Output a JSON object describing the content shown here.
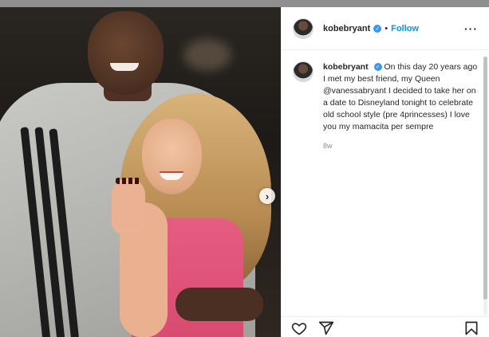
{
  "post": {
    "username": "kobebryant",
    "follow_label": "Follow",
    "separator": "•",
    "more_icon": "more-horizontal-icon",
    "verified_icon": "verified-badge-icon",
    "caption_text": "On this day 20 years ago I met my best friend, my Queen @vanessabryant I decided to take her on a date to Disneyland tonight to celebrate old school style (pre 4princesses) I love you my mamacita per sempre",
    "time": "8w",
    "next_icon": "chevron-right-icon",
    "actions": [
      "heart-icon",
      "share-icon",
      "bookmark-icon"
    ],
    "colors": {
      "follow": "#0095f6",
      "verified": "#3897f0",
      "dress": "#e55d80"
    }
  }
}
